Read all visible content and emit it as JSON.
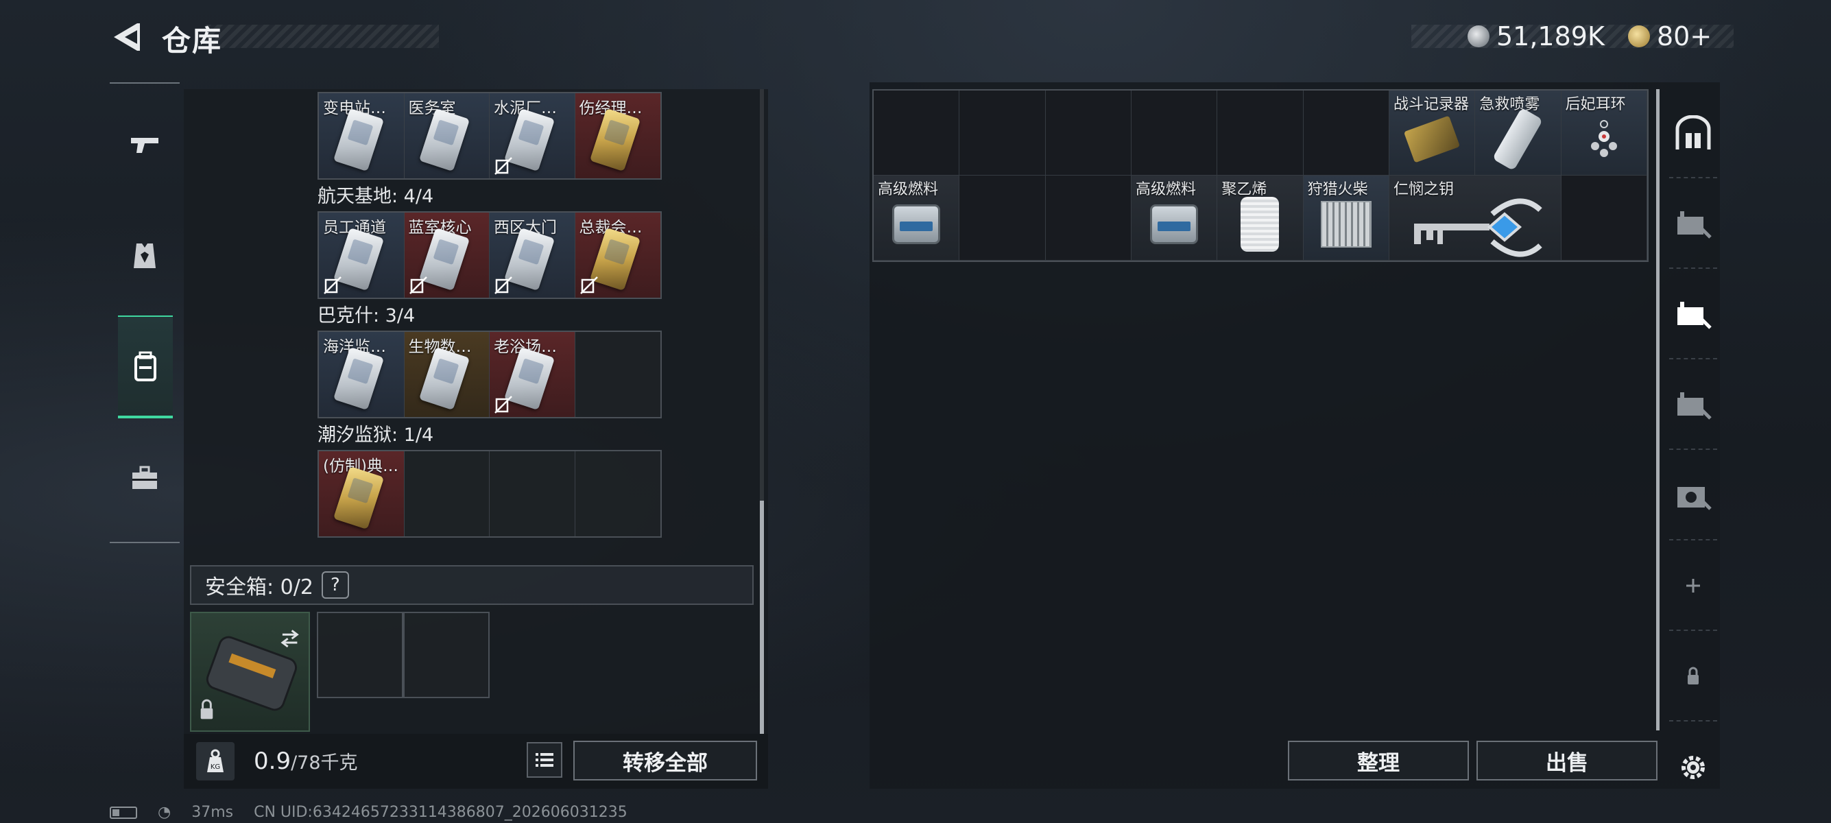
{
  "header": {
    "title": "仓库",
    "currency_silver": "51,189K",
    "currency_gold": "80+"
  },
  "left_nav": {
    "items": [
      {
        "name": "weapons",
        "icon": "pistol-icon"
      },
      {
        "name": "equipment",
        "icon": "vest-icon"
      },
      {
        "name": "backpack",
        "icon": "backpack-icon",
        "active": true
      },
      {
        "name": "toolbox",
        "icon": "toolbox-icon"
      }
    ]
  },
  "keycards": {
    "group1": [
      {
        "label": "变电站宿舍",
        "color": "blue",
        "no_use": false
      },
      {
        "label": "医务室",
        "color": "blue",
        "no_use": false
      },
      {
        "label": "水泥厂办…",
        "color": "blue",
        "no_use": true
      },
      {
        "label": "伤经理室东",
        "color": "red",
        "no_use": false
      }
    ],
    "group2_title": "航天基地: 4/4",
    "group2": [
      {
        "label": "员工通道",
        "color": "blue",
        "no_use": true
      },
      {
        "label": "蓝室核心",
        "color": "red",
        "no_use": true
      },
      {
        "label": "西区大门",
        "color": "blue",
        "no_use": true
      },
      {
        "label": "总裁会客厅",
        "color": "red",
        "no_use": true
      }
    ],
    "group3_title": "巴克什: 3/4",
    "group3": [
      {
        "label": "海洋监测厅",
        "color": "blue",
        "no_use": false
      },
      {
        "label": "生物数据…",
        "color": "gold",
        "no_use": false
      },
      {
        "label": "老浴场贵…",
        "color": "red",
        "no_use": true
      }
    ],
    "group4_title": "潮汐监狱: 1/4",
    "group4": [
      {
        "label": "(仿制)典…",
        "color": "red",
        "no_use": false
      }
    ]
  },
  "safebox": {
    "label": "安全箱: 0/2",
    "help": "?"
  },
  "weight": {
    "value": "0.9",
    "capacity": "/78千克",
    "icon_text": "KG"
  },
  "buttons": {
    "transfer_all": "转移全部",
    "arrange": "整理",
    "sell": "出售"
  },
  "stash": {
    "row1": [
      "",
      "",
      "",
      "",
      "",
      "",
      "战斗记录器",
      "急救喷雾",
      "后妃耳环"
    ],
    "row2": [
      "高级燃料",
      "",
      "",
      "高级燃料",
      "聚乙烯",
      "狩猎火柴",
      "仁悯之钥",
      "",
      ""
    ]
  },
  "status_bar": {
    "ping": "37ms",
    "uid": "CN UID:634246572331143868​07_202606031235"
  }
}
